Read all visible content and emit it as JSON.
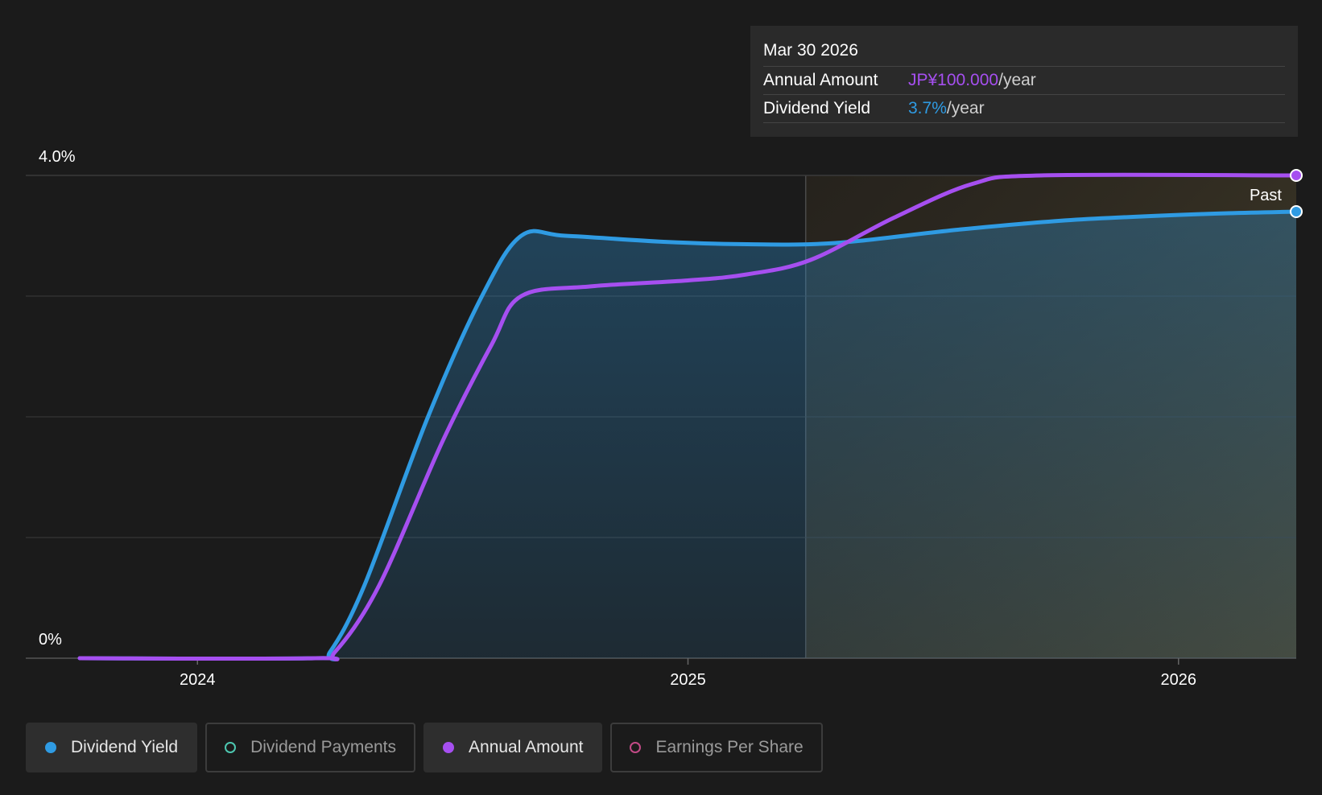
{
  "tooltip": {
    "date": "Mar 30 2026",
    "rows": [
      {
        "label": "Annual Amount",
        "value": "JP¥100.000",
        "unit": "/year"
      },
      {
        "label": "Dividend Yield",
        "value": "3.7%",
        "unit": "/year"
      }
    ]
  },
  "chart_data": {
    "type": "line",
    "y_axis": {
      "min": 0,
      "max": 4.0,
      "tick_labels": [
        "0%",
        "4.0%"
      ],
      "grid_lines": 5
    },
    "x_axis": {
      "min": 2023.65,
      "max": 2026.24,
      "ticks": [
        2024,
        2025,
        2026
      ],
      "tick_labels": [
        "2024",
        "2025",
        "2026"
      ]
    },
    "past_region_start": 2025.24,
    "past_label": "Past",
    "series": [
      {
        "name": "Dividend Yield",
        "color": "#2f9be3",
        "filled": true,
        "points": [
          [
            2023.76,
            0
          ],
          [
            2024.24,
            0
          ],
          [
            2024.27,
            0.05
          ],
          [
            2024.34,
            0.6
          ],
          [
            2024.47,
            2.0
          ],
          [
            2024.58,
            3.0
          ],
          [
            2024.66,
            3.5
          ],
          [
            2024.75,
            3.5
          ],
          [
            2024.95,
            3.45
          ],
          [
            2025.12,
            3.43
          ],
          [
            2025.3,
            3.44
          ],
          [
            2025.55,
            3.55
          ],
          [
            2025.78,
            3.63
          ],
          [
            2026.05,
            3.68
          ],
          [
            2026.24,
            3.7
          ]
        ]
      },
      {
        "name": "Annual Amount",
        "color": "#a64ff0",
        "filled": false,
        "points": [
          [
            2023.76,
            0
          ],
          [
            2024.24,
            0
          ],
          [
            2024.28,
            0.05
          ],
          [
            2024.37,
            0.6
          ],
          [
            2024.5,
            1.8
          ],
          [
            2024.6,
            2.6
          ],
          [
            2024.66,
            3.0
          ],
          [
            2024.8,
            3.08
          ],
          [
            2025.0,
            3.13
          ],
          [
            2025.12,
            3.18
          ],
          [
            2025.25,
            3.3
          ],
          [
            2025.42,
            3.65
          ],
          [
            2025.58,
            3.93
          ],
          [
            2025.72,
            4.0
          ],
          [
            2026.24,
            4.0
          ]
        ]
      }
    ]
  },
  "legend": [
    {
      "label": "Dividend Yield",
      "color": "#2f9be3",
      "active": true,
      "filled": true
    },
    {
      "label": "Dividend Payments",
      "color": "#4dc7b0",
      "active": false,
      "filled": false
    },
    {
      "label": "Annual Amount",
      "color": "#a64ff0",
      "active": true,
      "filled": true
    },
    {
      "label": "Earnings Per Share",
      "color": "#c24a86",
      "active": false,
      "filled": false
    }
  ]
}
